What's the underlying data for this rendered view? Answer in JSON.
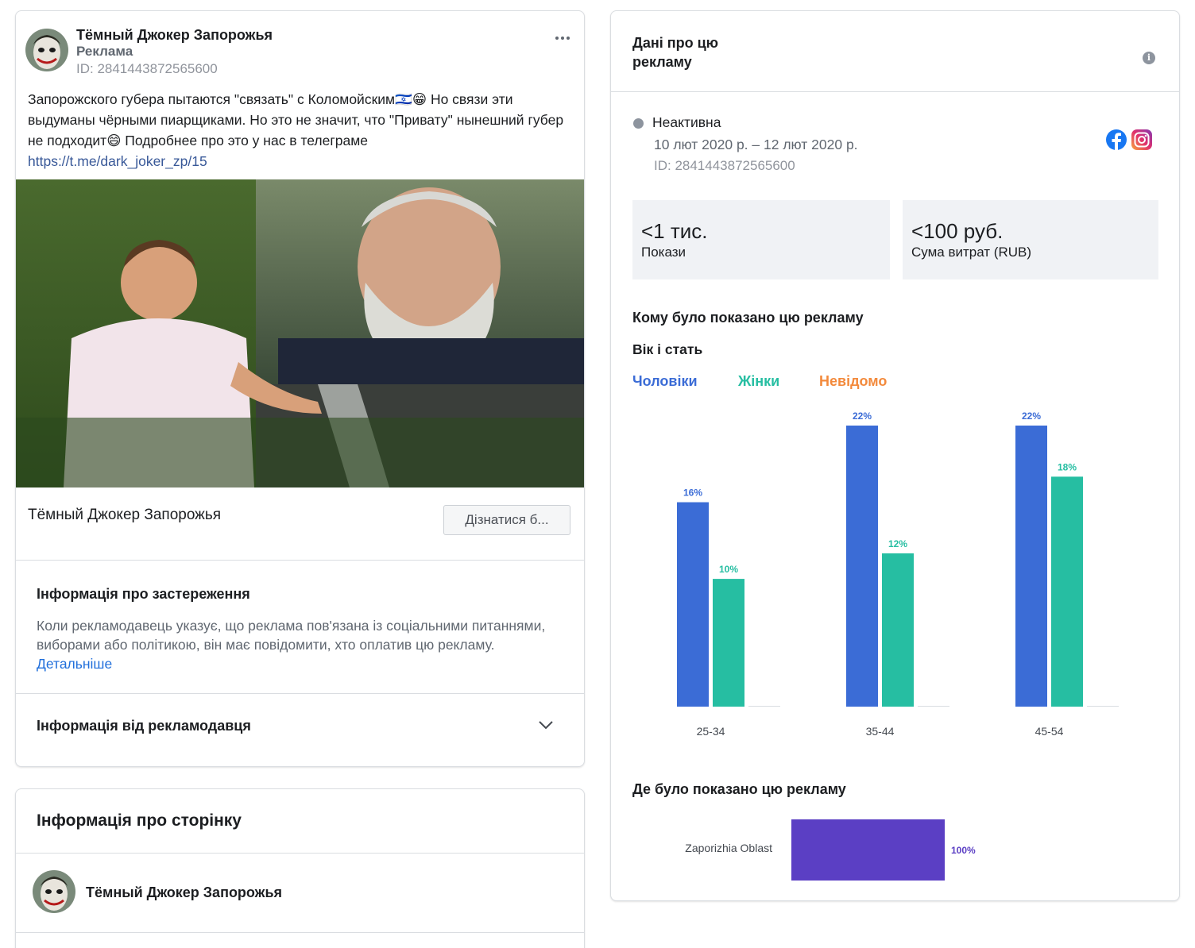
{
  "ad": {
    "page_name": "Тёмный Джокер Запорожья",
    "sponsored_label": "Реклама",
    "id_text": "ID: 2841443872565600",
    "body_text": "Запорожского губера пытаются \"связать\" с Коломойским🇮🇱😁 Но связи эти выдуманы чёрными пиарщиками. Но это не значит, что \"Привату\" нынешний губер не подходит😄 Подробнее про это у нас в телеграме",
    "link_text": "https://t.me/dark_joker_zp/15",
    "cta_page_name": "Тёмный Джокер Запорожья",
    "cta_button_label": "Дізнатися б...",
    "disclaimer_title": "Інформація про застереження",
    "disclaimer_body": "Коли рекламодавець указує, що реклама пов'язана із соціальними питаннями, виборами або політикою, він має повідомити, хто оплатив цю рекламу.",
    "disclaimer_link": "Детальніше",
    "advertiser_info_title": "Інформація від рекламодавця"
  },
  "page_info": {
    "title": "Інформація про сторінку",
    "page_name": "Тёмный Джокер Запорожья"
  },
  "details": {
    "title": "Дані про цю рекламу",
    "status": "Неактивна",
    "dates": "10 лют 2020 р. – 12 лют 2020 р.",
    "id_text": "ID: 2841443872565600",
    "impressions_value": "<1 тис.",
    "impressions_label": "Покази",
    "spend_value": "<100 руб.",
    "spend_label": "Сума витрат (RUB)",
    "who_title": "Кому було показано цю рекламу",
    "age_gender_title": "Вік і стать",
    "legend_men": "Чоловіки",
    "legend_women": "Жінки",
    "legend_unknown": "Невідомо",
    "where_title": "Де було показано цю рекламу"
  },
  "colors": {
    "men": "#3b6cd6",
    "women": "#26bea2",
    "unknown": "#f38a3c",
    "region": "#5b3fc4"
  },
  "chart_data": [
    {
      "type": "bar",
      "categories": [
        "25-34",
        "35-44",
        "45-54"
      ],
      "series": [
        {
          "name": "Чоловіки",
          "values": [
            16,
            22,
            22
          ],
          "labels": [
            "16%",
            "22%",
            "22%"
          ]
        },
        {
          "name": "Жінки",
          "values": [
            10,
            12,
            18
          ],
          "labels": [
            "10%",
            "12%",
            "18%"
          ]
        },
        {
          "name": "Невідомо",
          "values": [
            0,
            0,
            0
          ]
        }
      ],
      "ylim": [
        0,
        22
      ]
    },
    {
      "type": "bar",
      "orientation": "horizontal",
      "categories": [
        "Zaporizhia Oblast"
      ],
      "values": [
        100
      ],
      "labels": [
        "100%"
      ],
      "xlim": [
        0,
        100
      ]
    }
  ]
}
